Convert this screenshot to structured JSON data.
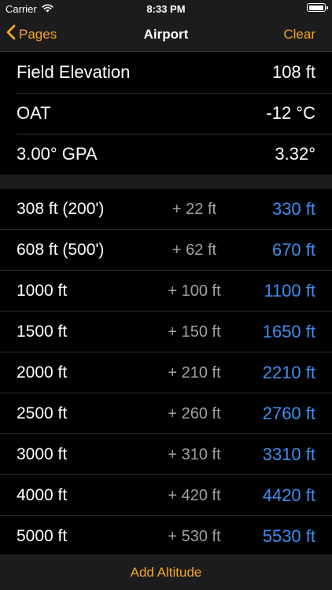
{
  "status_bar": {
    "carrier": "Carrier",
    "time": "8:33 PM",
    "wifi_icon": "wifi-icon",
    "battery_icon": "battery-icon",
    "battery_level": 1.0
  },
  "nav": {
    "back_label": "Pages",
    "back_icon": "chevron-left-icon",
    "title": "Airport",
    "clear_label": "Clear"
  },
  "airport": {
    "field_elevation": {
      "label": "Field Elevation",
      "value": "108 ft"
    },
    "oat": {
      "label": "OAT",
      "value": "-12 °C"
    },
    "gpa": {
      "label": "3.00° GPA",
      "value": "3.32°"
    }
  },
  "altitudes": [
    {
      "base": "308 ft  (200')",
      "add": "+ 22 ft",
      "corrected": "330 ft"
    },
    {
      "base": "608 ft  (500')",
      "add": "+ 62 ft",
      "corrected": "670 ft"
    },
    {
      "base": "1000 ft",
      "add": "+ 100 ft",
      "corrected": "1100 ft"
    },
    {
      "base": "1500 ft",
      "add": "+ 150 ft",
      "corrected": "1650 ft"
    },
    {
      "base": "2000 ft",
      "add": "+ 210 ft",
      "corrected": "2210 ft"
    },
    {
      "base": "2500 ft",
      "add": "+ 260 ft",
      "corrected": "2760 ft"
    },
    {
      "base": "3000 ft",
      "add": "+ 310 ft",
      "corrected": "3310 ft"
    },
    {
      "base": "4000 ft",
      "add": "+ 420 ft",
      "corrected": "4420 ft"
    },
    {
      "base": "5000 ft",
      "add": "+ 530 ft",
      "corrected": "5530 ft"
    }
  ],
  "toolbar": {
    "add_altitude_label": "Add Altitude"
  },
  "colors": {
    "accent": "#f5a623",
    "corrected_value": "#3d8ff0",
    "background": "#000000",
    "bar_background": "#1c1c1e"
  }
}
